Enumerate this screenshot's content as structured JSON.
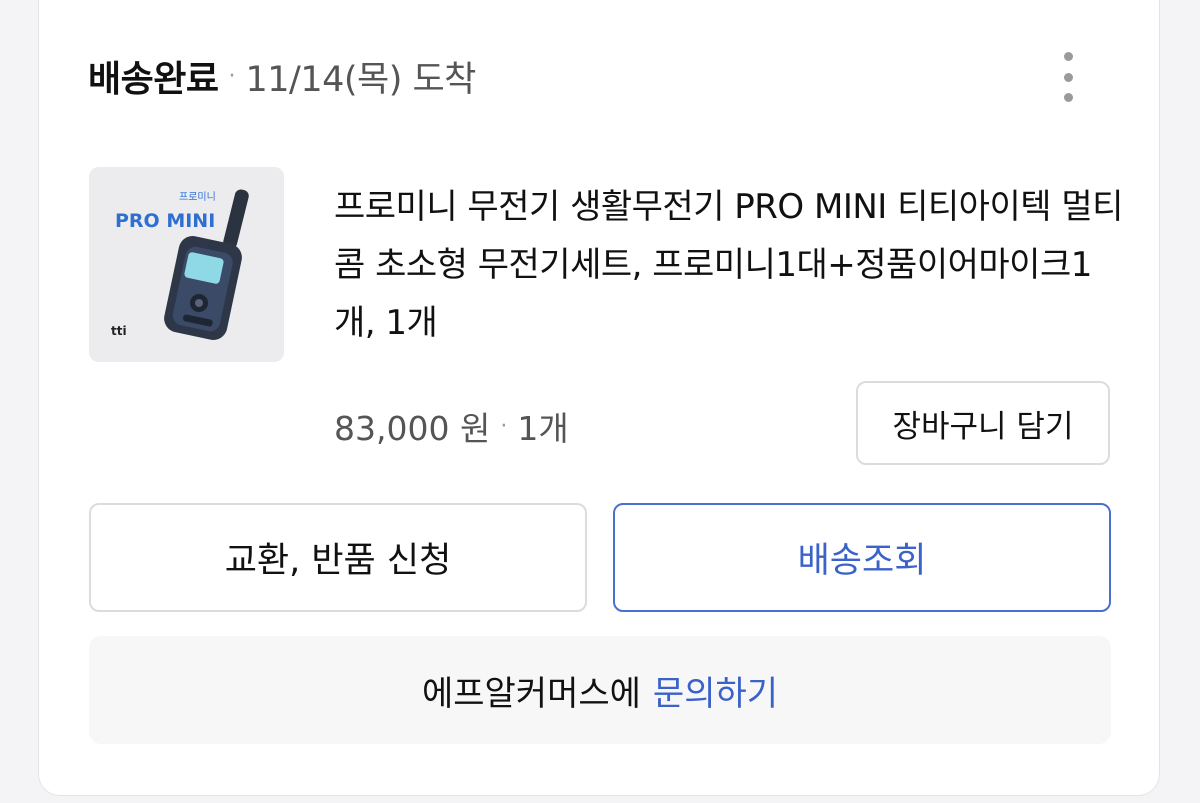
{
  "order": {
    "status": "배송완료",
    "separator": "·",
    "arrival": "11/14(목) 도착",
    "more_icon": "more-vertical-icon"
  },
  "product": {
    "thumbnail": {
      "brand_korean": "프로미니",
      "brand_text": "PRO MINI",
      "maker_logo": "tti"
    },
    "name": "프로미니 무전기 생활무전기 PRO MINI 티티아이텍 멀티콤 초소형 무전기세트, 프로미니1대+정품이어마이크1개, 1개",
    "price": "83,000 원",
    "separator": "·",
    "quantity": "1개",
    "cart_label": "장바구니 담기"
  },
  "actions": {
    "return_label": "교환, 반품 신청",
    "track_label": "배송조회"
  },
  "inquiry": {
    "prefix": "에프알커머스에",
    "link_label": "문의하기"
  },
  "colors": {
    "accent": "#3a62c9",
    "border": "#dcdcdc",
    "muted": "#555555",
    "panel": "#f7f7f8"
  }
}
